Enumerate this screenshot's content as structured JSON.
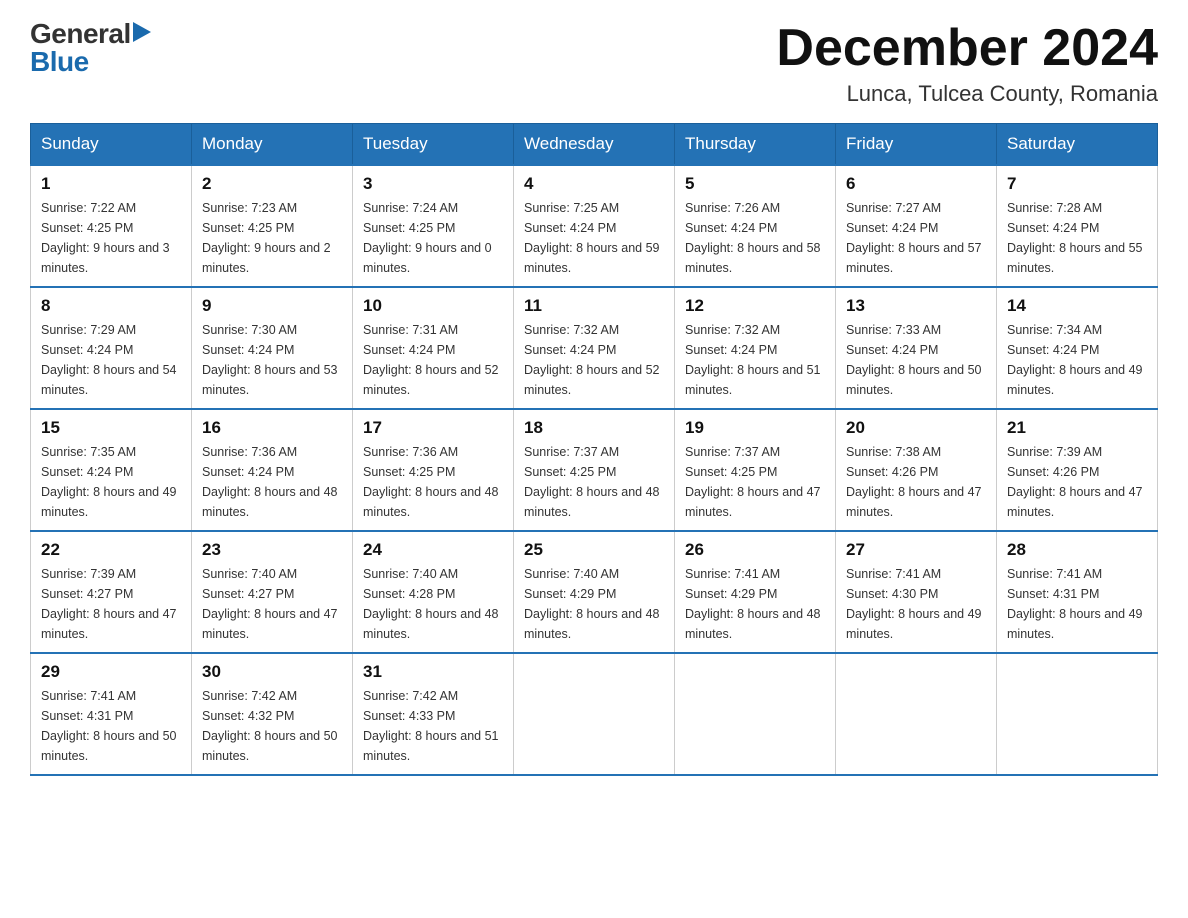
{
  "header": {
    "logo_general": "General",
    "logo_blue": "Blue",
    "month_title": "December 2024",
    "location": "Lunca, Tulcea County, Romania"
  },
  "days_of_week": [
    "Sunday",
    "Monday",
    "Tuesday",
    "Wednesday",
    "Thursday",
    "Friday",
    "Saturday"
  ],
  "weeks": [
    [
      {
        "day": "1",
        "sunrise": "7:22 AM",
        "sunset": "4:25 PM",
        "daylight": "9 hours and 3 minutes."
      },
      {
        "day": "2",
        "sunrise": "7:23 AM",
        "sunset": "4:25 PM",
        "daylight": "9 hours and 2 minutes."
      },
      {
        "day": "3",
        "sunrise": "7:24 AM",
        "sunset": "4:25 PM",
        "daylight": "9 hours and 0 minutes."
      },
      {
        "day": "4",
        "sunrise": "7:25 AM",
        "sunset": "4:24 PM",
        "daylight": "8 hours and 59 minutes."
      },
      {
        "day": "5",
        "sunrise": "7:26 AM",
        "sunset": "4:24 PM",
        "daylight": "8 hours and 58 minutes."
      },
      {
        "day": "6",
        "sunrise": "7:27 AM",
        "sunset": "4:24 PM",
        "daylight": "8 hours and 57 minutes."
      },
      {
        "day": "7",
        "sunrise": "7:28 AM",
        "sunset": "4:24 PM",
        "daylight": "8 hours and 55 minutes."
      }
    ],
    [
      {
        "day": "8",
        "sunrise": "7:29 AM",
        "sunset": "4:24 PM",
        "daylight": "8 hours and 54 minutes."
      },
      {
        "day": "9",
        "sunrise": "7:30 AM",
        "sunset": "4:24 PM",
        "daylight": "8 hours and 53 minutes."
      },
      {
        "day": "10",
        "sunrise": "7:31 AM",
        "sunset": "4:24 PM",
        "daylight": "8 hours and 52 minutes."
      },
      {
        "day": "11",
        "sunrise": "7:32 AM",
        "sunset": "4:24 PM",
        "daylight": "8 hours and 52 minutes."
      },
      {
        "day": "12",
        "sunrise": "7:32 AM",
        "sunset": "4:24 PM",
        "daylight": "8 hours and 51 minutes."
      },
      {
        "day": "13",
        "sunrise": "7:33 AM",
        "sunset": "4:24 PM",
        "daylight": "8 hours and 50 minutes."
      },
      {
        "day": "14",
        "sunrise": "7:34 AM",
        "sunset": "4:24 PM",
        "daylight": "8 hours and 49 minutes."
      }
    ],
    [
      {
        "day": "15",
        "sunrise": "7:35 AM",
        "sunset": "4:24 PM",
        "daylight": "8 hours and 49 minutes."
      },
      {
        "day": "16",
        "sunrise": "7:36 AM",
        "sunset": "4:24 PM",
        "daylight": "8 hours and 48 minutes."
      },
      {
        "day": "17",
        "sunrise": "7:36 AM",
        "sunset": "4:25 PM",
        "daylight": "8 hours and 48 minutes."
      },
      {
        "day": "18",
        "sunrise": "7:37 AM",
        "sunset": "4:25 PM",
        "daylight": "8 hours and 48 minutes."
      },
      {
        "day": "19",
        "sunrise": "7:37 AM",
        "sunset": "4:25 PM",
        "daylight": "8 hours and 47 minutes."
      },
      {
        "day": "20",
        "sunrise": "7:38 AM",
        "sunset": "4:26 PM",
        "daylight": "8 hours and 47 minutes."
      },
      {
        "day": "21",
        "sunrise": "7:39 AM",
        "sunset": "4:26 PM",
        "daylight": "8 hours and 47 minutes."
      }
    ],
    [
      {
        "day": "22",
        "sunrise": "7:39 AM",
        "sunset": "4:27 PM",
        "daylight": "8 hours and 47 minutes."
      },
      {
        "day": "23",
        "sunrise": "7:40 AM",
        "sunset": "4:27 PM",
        "daylight": "8 hours and 47 minutes."
      },
      {
        "day": "24",
        "sunrise": "7:40 AM",
        "sunset": "4:28 PM",
        "daylight": "8 hours and 48 minutes."
      },
      {
        "day": "25",
        "sunrise": "7:40 AM",
        "sunset": "4:29 PM",
        "daylight": "8 hours and 48 minutes."
      },
      {
        "day": "26",
        "sunrise": "7:41 AM",
        "sunset": "4:29 PM",
        "daylight": "8 hours and 48 minutes."
      },
      {
        "day": "27",
        "sunrise": "7:41 AM",
        "sunset": "4:30 PM",
        "daylight": "8 hours and 49 minutes."
      },
      {
        "day": "28",
        "sunrise": "7:41 AM",
        "sunset": "4:31 PM",
        "daylight": "8 hours and 49 minutes."
      }
    ],
    [
      {
        "day": "29",
        "sunrise": "7:41 AM",
        "sunset": "4:31 PM",
        "daylight": "8 hours and 50 minutes."
      },
      {
        "day": "30",
        "sunrise": "7:42 AM",
        "sunset": "4:32 PM",
        "daylight": "8 hours and 50 minutes."
      },
      {
        "day": "31",
        "sunrise": "7:42 AM",
        "sunset": "4:33 PM",
        "daylight": "8 hours and 51 minutes."
      },
      null,
      null,
      null,
      null
    ]
  ]
}
